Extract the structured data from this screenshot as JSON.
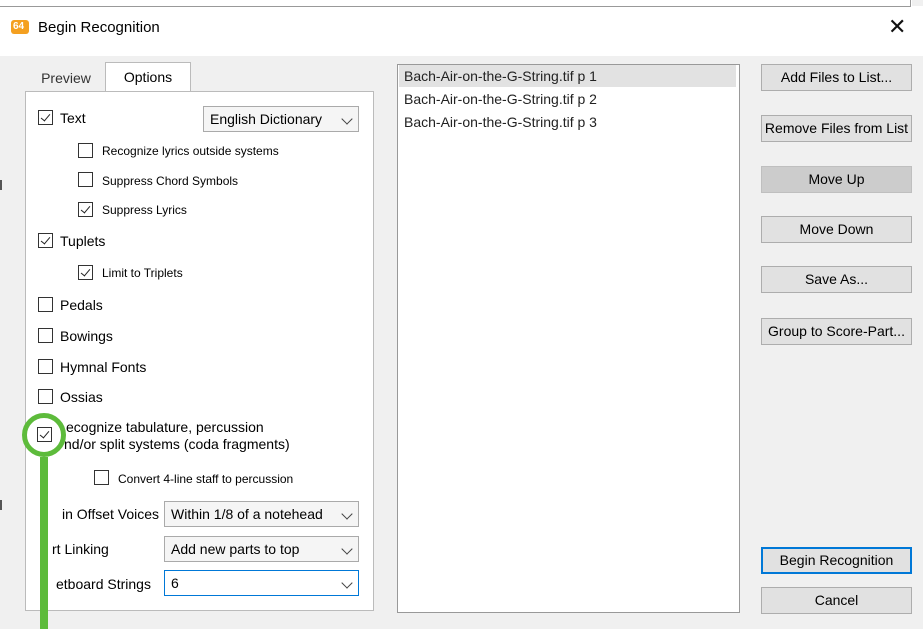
{
  "window": {
    "title": "Begin Recognition",
    "close_label": "✕",
    "icon": "app-icon"
  },
  "tabs": [
    {
      "label": "Preview"
    },
    {
      "label": "Options"
    }
  ],
  "options": {
    "text": {
      "label": "Text",
      "checked": true,
      "dictionary": "English Dictionary"
    },
    "recognize_lyrics": {
      "label": "Recognize lyrics outside systems",
      "checked": false
    },
    "suppress_chords": {
      "label": "Suppress Chord Symbols",
      "checked": false
    },
    "suppress_lyrics": {
      "label": "Suppress Lyrics",
      "checked": true
    },
    "tuplets": {
      "label": "Tuplets",
      "checked": true
    },
    "limit_triplets": {
      "label": "Limit to Triplets",
      "checked": true
    },
    "pedals": {
      "label": "Pedals",
      "checked": false
    },
    "bowings": {
      "label": "Bowings",
      "checked": false
    },
    "hymnal": {
      "label": "Hymnal Fonts",
      "checked": false
    },
    "ossias": {
      "label": "Ossias",
      "checked": false
    },
    "tablature": {
      "line1": "ecognize tabulature, percussion",
      "line2": "nd/or split systems (coda fragments)",
      "checked": true
    },
    "convert4": {
      "label": "Convert 4-line staff to percussion",
      "checked": false
    },
    "offset_voices": {
      "label": "in Offset Voices",
      "value": "Within 1/8 of a notehead"
    },
    "part_linking": {
      "label": "rt Linking",
      "value": "Add new parts to top"
    },
    "fretboard": {
      "label": "etboard Strings",
      "value": "6"
    }
  },
  "files": [
    {
      "name": "Bach-Air-on-the-G-String.tif p  1",
      "selected": true
    },
    {
      "name": "Bach-Air-on-the-G-String.tif p  2",
      "selected": false
    },
    {
      "name": "Bach-Air-on-the-G-String.tif p  3",
      "selected": false
    }
  ],
  "buttons": {
    "add_files": "Add Files to List...",
    "remove_files": "Remove Files from List",
    "move_up": "Move Up",
    "move_down": "Move Down",
    "save_as": "Save As...",
    "group": "Group to Score-Part...",
    "begin": "Begin Recognition",
    "cancel": "Cancel"
  },
  "colors": {
    "highlight": "#5dbb3b",
    "accent": "#0078d7"
  }
}
